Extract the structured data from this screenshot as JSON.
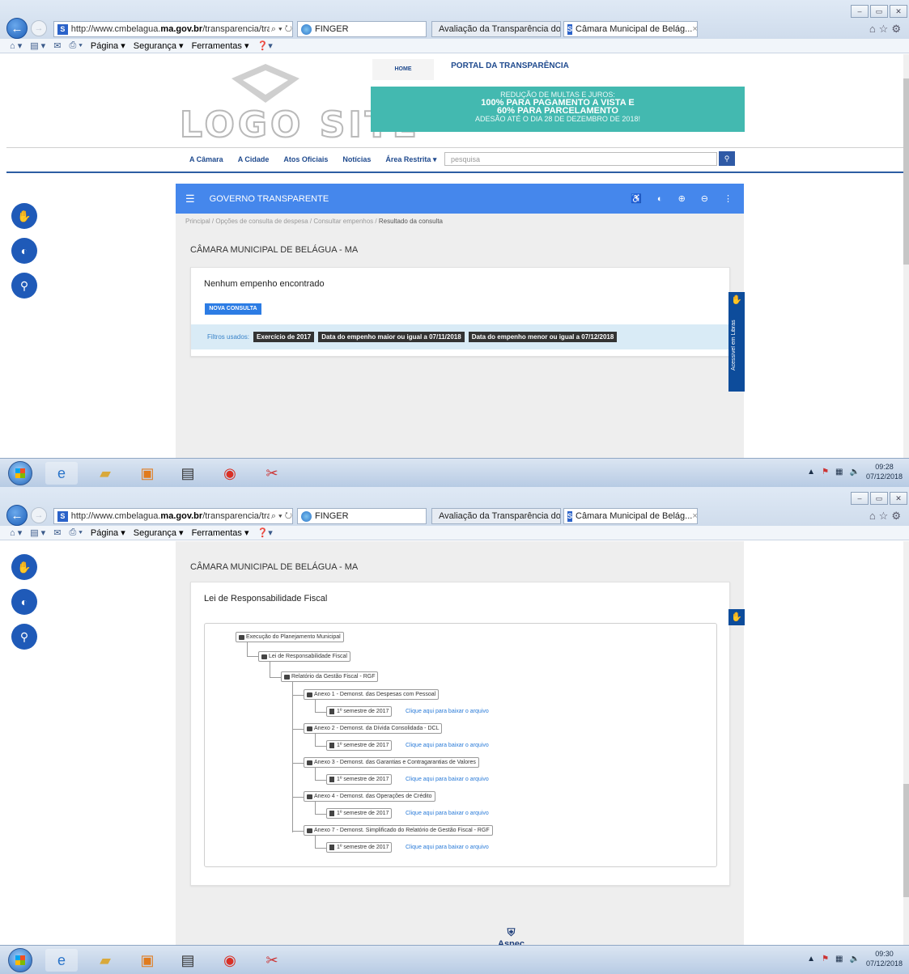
{
  "browser": {
    "url_prefix": "http://www.cmbelagua.",
    "url_domain": "ma.gov.br",
    "url_suffix": "/transparencia/tran",
    "tab_finger": "FINGER",
    "tab_avaliacao": "Avaliação da Transparência do...",
    "tab_camara_1": "Câmara Municipal de Belág...",
    "tab_camara_2": "Câmara Municipal de Belág...",
    "menu": {
      "pagina": "Página ▾",
      "seguranca": "Segurança ▾",
      "ferramentas": "Ferramentas ▾"
    }
  },
  "site": {
    "logo_text": "LOGO SITE",
    "nav_home": "HOME",
    "nav_portal": "PORTAL DA TRANSPARÊNCIA",
    "banner": {
      "line1": "REDUÇÃO DE MULTAS E JUROS:",
      "line2": "100% PARA PAGAMENTO A VISTA E",
      "line3": "60% PARA PARCELAMENTO",
      "line4": "ADESÃO ATÉ O DIA 28 DE DEZEMBRO DE 2018!"
    },
    "menu": [
      "A Câmara",
      "A Cidade",
      "Atos Oficiais",
      "Notícias",
      "Área Restrita ▾"
    ],
    "search_placeholder": "pesquisa"
  },
  "portal": {
    "bar_title": "GOVERNO TRANSPARENTE",
    "breadcrumb": [
      "Principal",
      "Opções de consulta de despesa",
      "Consultar empenhos",
      "Resultado da consulta"
    ],
    "entity": "CÂMARA MUNICIPAL DE BELÁGUA - MA",
    "no_result": "Nenhum empenho encontrado",
    "new_query_btn": "NOVA CONSULTA",
    "filters_label": "Filtros usados:",
    "filters": [
      "Exercício de 2017",
      "Data do empenho maior ou igual a 07/11/2018",
      "Data do empenho menor ou igual a 07/12/2018"
    ],
    "vlibras": "Acessível em Libras"
  },
  "lrf": {
    "entity": "CÂMARA MUNICIPAL DE BELÁGUA - MA",
    "title": "Lei de Responsabilidade Fiscal",
    "root": "Execução do Planejamento Municipal",
    "lrf": "Lei de Responsabilidade Fiscal",
    "rgf": "Relatório da Gestão Fiscal - RGF",
    "annexes": [
      {
        "name": "Anexo 1 - Demonst. das Despesas com Pessoal",
        "file": "1º semestre de 2017",
        "link": "Clique aqui para baixar o arquivo"
      },
      {
        "name": "Anexo 2 - Demonst. da Dívida Consolidada - DCL",
        "file": "1º semestre de 2017",
        "link": "Clique aqui para baixar o arquivo"
      },
      {
        "name": "Anexo 3 - Demonst. das Garantias e Contragarantias de Valores",
        "file": "1º semestre de 2017",
        "link": "Clique aqui para baixar o arquivo"
      },
      {
        "name": "Anexo 4 - Demonst. das Operações de Crédito",
        "file": "1º semestre de 2017",
        "link": "Clique aqui para baixar o arquivo"
      },
      {
        "name": "Anexo 7 - Demonst. Simplificado do Relatório de Gestão Fiscal - RGF",
        "file": "1º semestre de 2017",
        "link": "Clique aqui para baixar o arquivo"
      }
    ],
    "footer_logo": "Aspec"
  },
  "taskbar": {
    "time_1": "09:28",
    "date_1": "07/12/2018",
    "time_2": "09:30",
    "date_2": "07/12/2018"
  }
}
